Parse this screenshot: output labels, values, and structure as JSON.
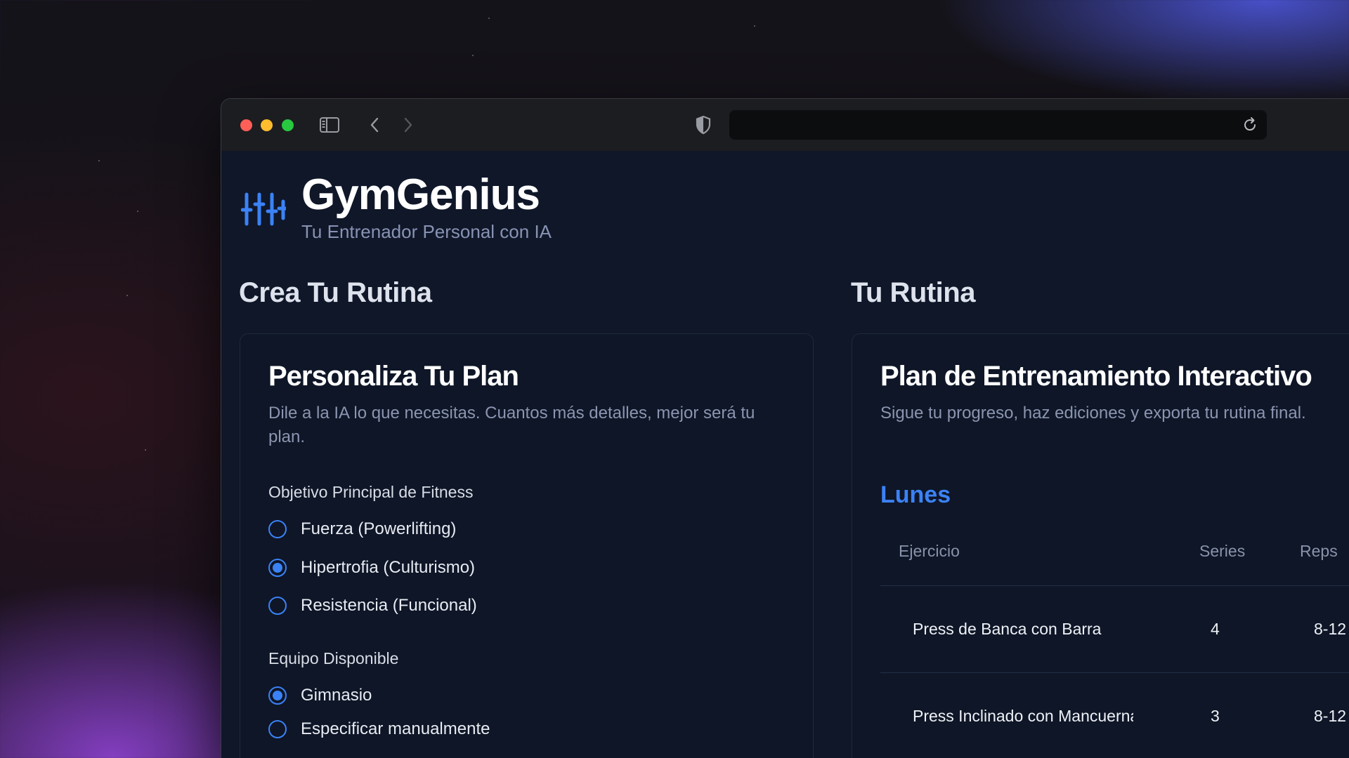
{
  "app": {
    "title": "GymGenius",
    "subtitle": "Tu Entrenador Personal con IA",
    "accent_color": "#3b82f6"
  },
  "left_section": {
    "heading": "Crea Tu Rutina",
    "card_title": "Personaliza Tu Plan",
    "card_description": "Dile a la IA lo que necesitas. Cuantos más detalles, mejor será tu plan.",
    "goal": {
      "label": "Objetivo Principal de Fitness",
      "options": [
        {
          "label": "Fuerza (Powerlifting)",
          "selected": false
        },
        {
          "label": "Hipertrofia (Culturismo)",
          "selected": true
        },
        {
          "label": "Resistencia (Funcional)",
          "selected": false
        }
      ]
    },
    "equipment": {
      "label": "Equipo Disponible",
      "options": [
        {
          "label": "Gimnasio",
          "selected": true
        },
        {
          "label": "Especificar manualmente",
          "selected": false
        }
      ]
    }
  },
  "right_section": {
    "heading": "Tu Rutina",
    "card_title": "Plan de Entrenamiento Interactivo",
    "card_description": "Sigue tu progreso, haz ediciones y exporta tu rutina final.",
    "day": "Lunes",
    "table": {
      "headers": {
        "exercise": "Ejercicio",
        "series": "Series",
        "reps": "Reps"
      },
      "rows": [
        {
          "exercise": "Press de Banca con Barra",
          "series": "4",
          "reps": "8-12"
        },
        {
          "exercise": "Press Inclinado con Mancuernas",
          "series": "3",
          "reps": "8-12"
        }
      ]
    }
  },
  "browser": {
    "icons": [
      "sidebar-toggle-icon",
      "back-arrow-icon",
      "forward-arrow-icon",
      "shield-icon",
      "reload-icon"
    ],
    "url": ""
  }
}
